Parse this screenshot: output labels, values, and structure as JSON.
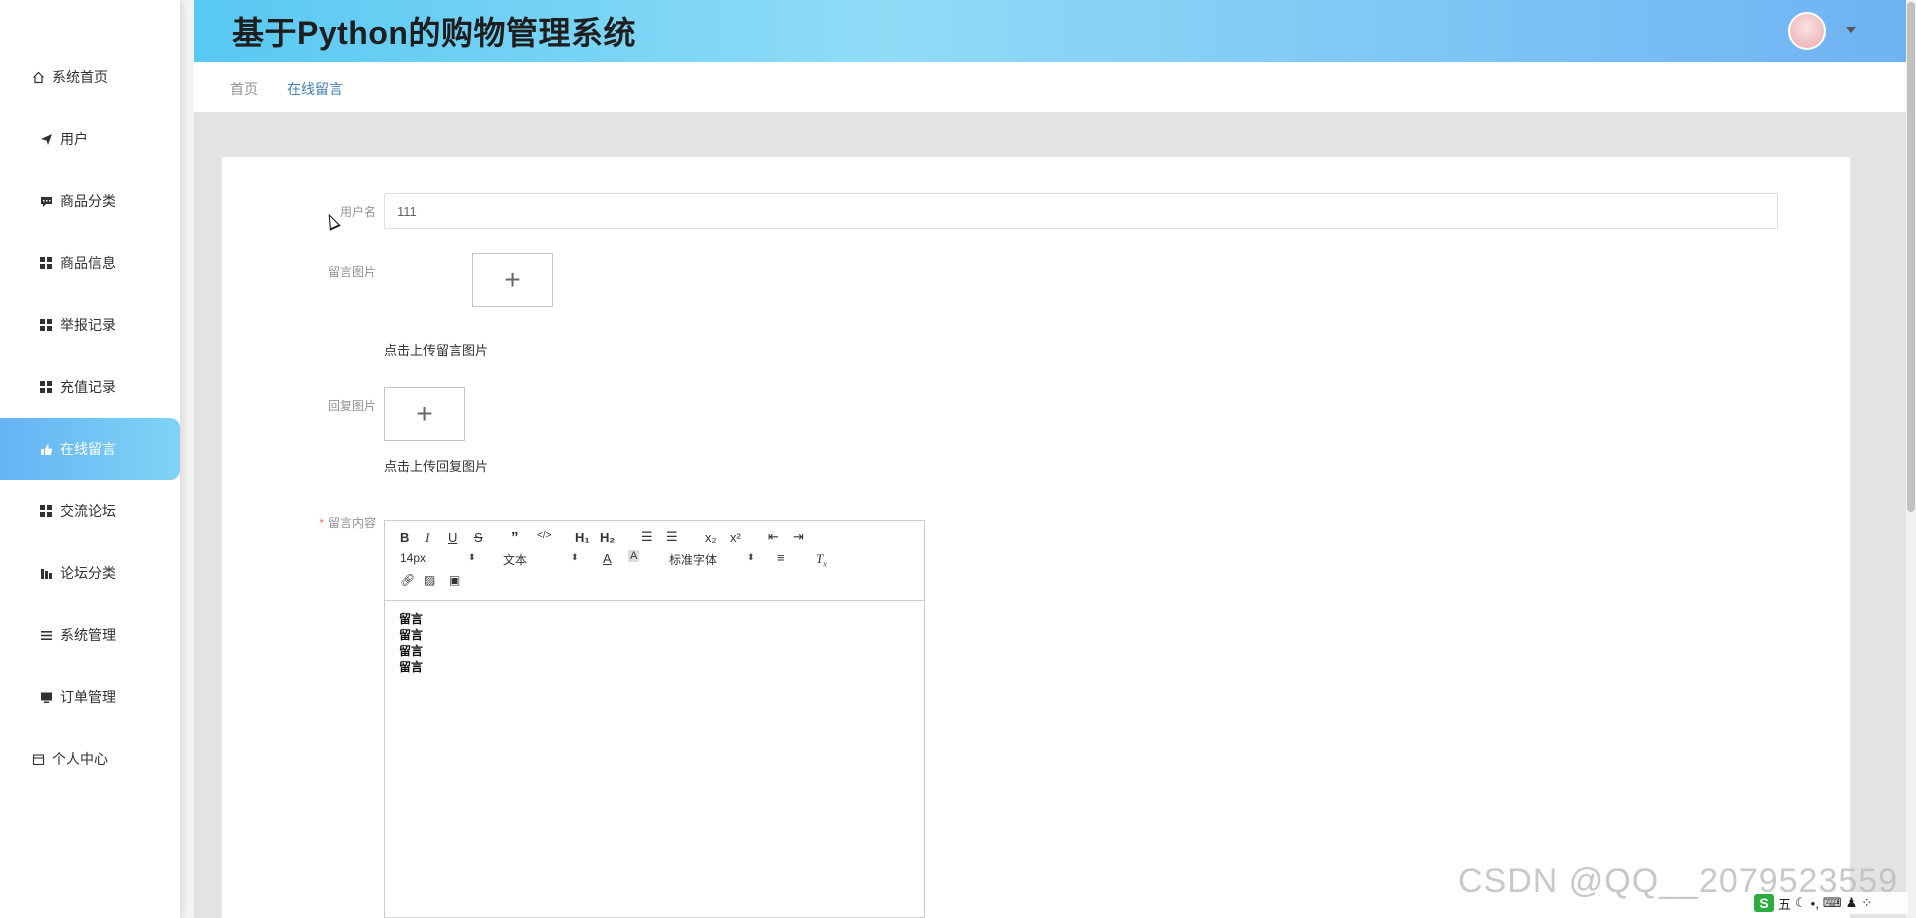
{
  "app": {
    "title": "基于Python的购物管理系统"
  },
  "sidebar": {
    "items": [
      {
        "label": "系统首页",
        "icon": "home-icon"
      },
      {
        "label": "用户",
        "icon": "paper-plane-icon"
      },
      {
        "label": "商品分类",
        "icon": "chat-icon"
      },
      {
        "label": "商品信息",
        "icon": "grid-icon"
      },
      {
        "label": "举报记录",
        "icon": "grid-icon"
      },
      {
        "label": "充值记录",
        "icon": "grid-icon"
      },
      {
        "label": "在线留言",
        "icon": "thumb-up-icon",
        "active": true
      },
      {
        "label": "交流论坛",
        "icon": "grid-icon"
      },
      {
        "label": "论坛分类",
        "icon": "bar-chart-icon"
      },
      {
        "label": "系统管理",
        "icon": "list-icon"
      },
      {
        "label": "订单管理",
        "icon": "monitor-icon"
      },
      {
        "label": "个人中心",
        "icon": "calendar-icon"
      }
    ]
  },
  "breadcrumb": {
    "home": "首页",
    "current": "在线留言"
  },
  "form": {
    "username_label": "用户名",
    "username_value": "111",
    "message_image_label": "留言图片",
    "message_image_hint": "点击上传留言图片",
    "reply_image_label": "回复图片",
    "reply_image_hint": "点击上传回复图片",
    "content_label": "留言内容",
    "content_required_mark": "*",
    "upload_plus": "+"
  },
  "editor": {
    "font_size": "14px",
    "header_select": "文本",
    "font_family": "标准字体",
    "content_lines": [
      "留言",
      "留言",
      "留言",
      "留言"
    ]
  },
  "watermark": "CSDN @QQ__2079523559",
  "ime": {
    "mode": "五"
  },
  "colors": {
    "accent": "#65b3f5",
    "header_start": "#58c8f2",
    "header_end": "#6fb3f3",
    "active_crumb": "#3e7fb0"
  }
}
